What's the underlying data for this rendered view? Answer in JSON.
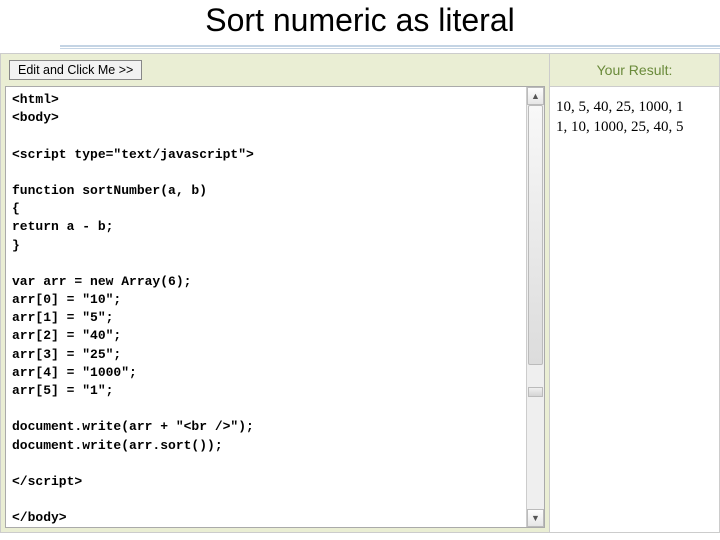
{
  "title": "Sort numeric as literal",
  "toolbar": {
    "run_label": "Edit and Click Me >>"
  },
  "editor": {
    "code": "<html>\n<body>\n\n<script type=\"text/javascript\">\n\nfunction sortNumber(a, b)\n{\nreturn a - b;\n}\n\nvar arr = new Array(6);\narr[0] = \"10\";\narr[1] = \"5\";\narr[2] = \"40\";\narr[3] = \"25\";\narr[4] = \"1000\";\narr[5] = \"1\";\n\ndocument.write(arr + \"<br />\");\ndocument.write(arr.sort());\n\n</script>\n\n</body>\n</html>"
  },
  "result": {
    "header": "Your Result:",
    "line1": "10, 5, 40, 25, 1000, 1",
    "line2": "1, 10, 1000, 25, 40, 5"
  },
  "scroll": {
    "up_glyph": "▲",
    "down_glyph": "▼"
  }
}
